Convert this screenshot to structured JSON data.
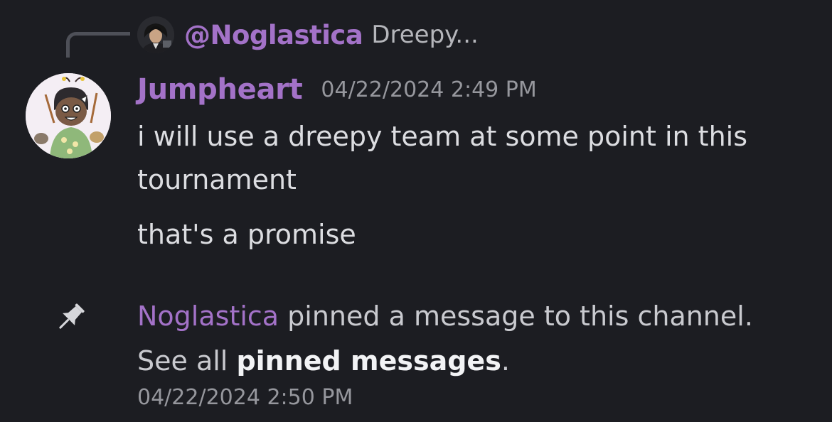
{
  "reply": {
    "author": "@Noglastica",
    "preview": "Dreepy..."
  },
  "message": {
    "author": "Jumpheart",
    "timestamp": "04/22/2024 2:49 PM",
    "line1": "i will use a dreepy team at some point in this tournament",
    "line2": "that's a promise"
  },
  "system_message": {
    "author": "Noglastica",
    "text_before_link": "pinned a message to this channel. See all",
    "link_text": "pinned messages",
    "text_after_link": ".",
    "timestamp": "04/22/2024 2:50 PM"
  },
  "colors": {
    "background": "#1c1d22",
    "author_accent": "#a372c8",
    "body_text": "#dcdde1",
    "muted_text": "#96979d"
  },
  "icons": {
    "pin": "pin-icon",
    "reply_connector": "reply-spine"
  }
}
